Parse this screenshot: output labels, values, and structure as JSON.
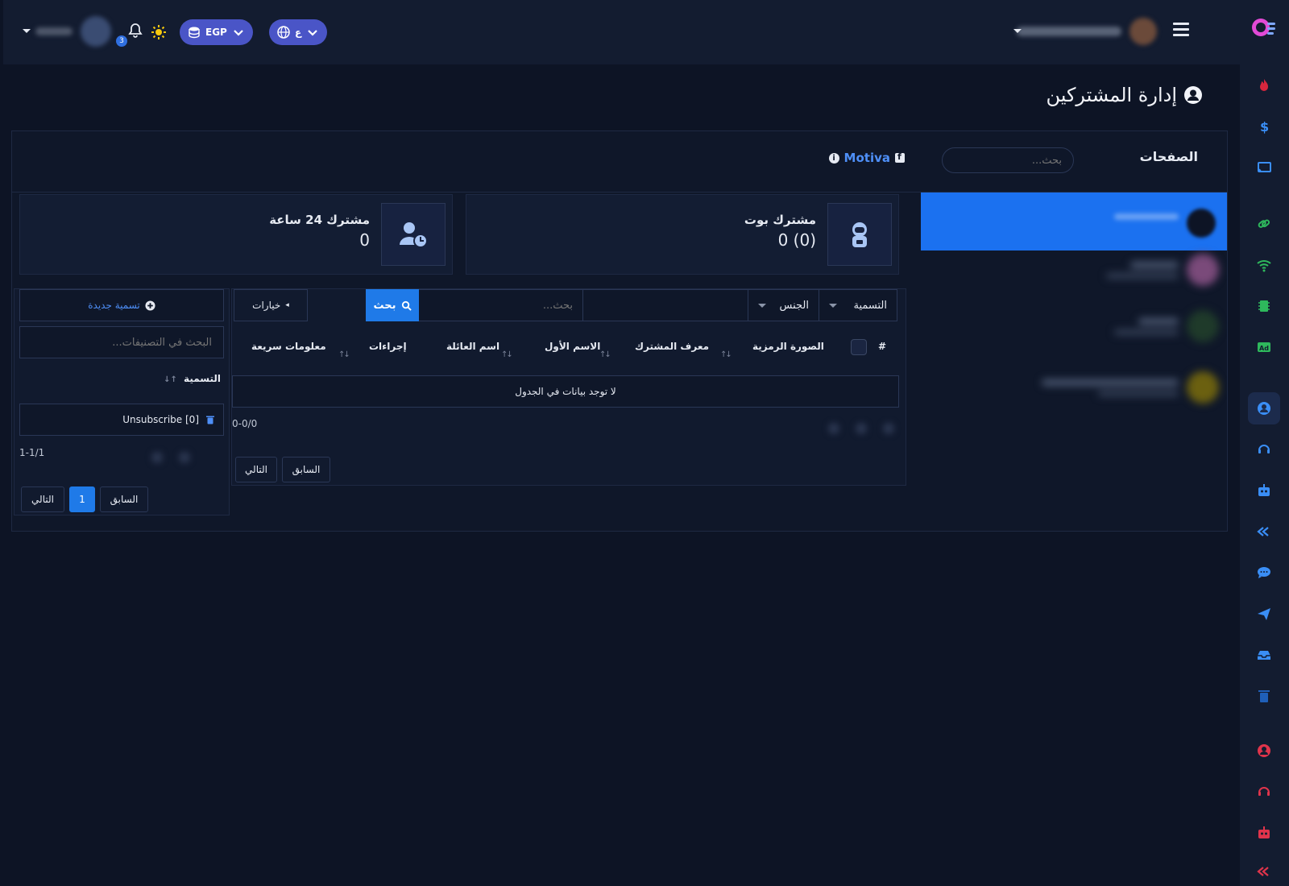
{
  "topbar": {
    "language_label": "ع",
    "currency_label": "EGP",
    "notification_count": "3"
  },
  "page": {
    "title": "إدارة المشتركين"
  },
  "pages_panel": {
    "label": "الصفحات",
    "search_placeholder": "بحث...",
    "selected_page": "Motiva",
    "info_icon": "ⓘ"
  },
  "stats": {
    "bot_subscribers": {
      "label": "مشترك بوت",
      "value": "0 (0)"
    },
    "subscribers_24h": {
      "label": "مشترك 24 ساعة",
      "value": "0"
    }
  },
  "subscribers_table": {
    "filter_label": "التسمية",
    "filter_gender": "الجنس",
    "search_placeholder": "بحث...",
    "search_button": "بحث",
    "options_button": "خيارات",
    "columns": [
      "#",
      "الصورة الرمزية",
      "معرف المشترك",
      "الاسم الأول",
      "اسم العائلة",
      "إجراءات",
      "معلومات سريعة"
    ],
    "empty_message": "لا توجد بيانات في الجدول",
    "range": "0-0/0",
    "prev": "السابق",
    "next": "التالي"
  },
  "labels_panel": {
    "new_label_button": "تسمية جديدة",
    "search_placeholder": "البحث في التصنيفات...",
    "column": "التسمية",
    "items": [
      {
        "name": "Unsubscribe [0]"
      }
    ],
    "range": "1-1/1",
    "prev": "السابق",
    "current_page": "1",
    "next": "التالي"
  },
  "colors": {
    "accent": "#1f7ae8",
    "pill": "#4a55c7",
    "background": "#0d1425"
  }
}
